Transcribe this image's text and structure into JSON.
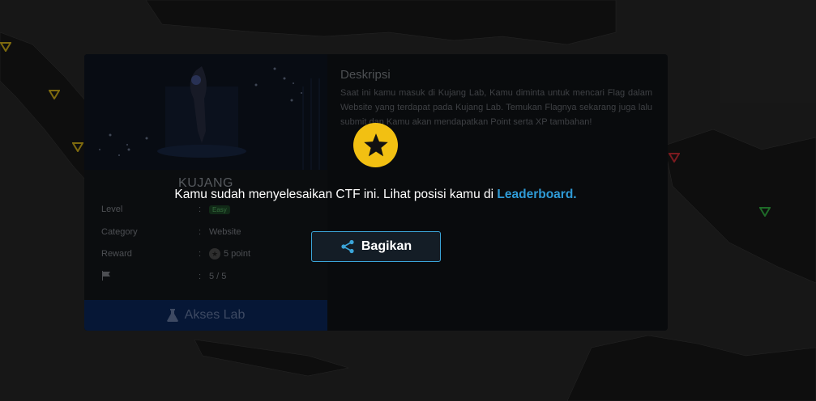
{
  "card": {
    "title": "KUJANG",
    "info": [
      {
        "key": "Level",
        "sep": ":",
        "value": "Easy"
      },
      {
        "key": "Category",
        "sep": ":",
        "value": "Website"
      },
      {
        "key": "Reward",
        "sep": ":",
        "value": "5 point"
      },
      {
        "sep": ":",
        "value": "5 / 5",
        "icon": "flag-icon"
      }
    ],
    "lab_button": "Akses Lab",
    "description_title": "Deskripsi",
    "description_text": "Saat ini kamu masuk di Kujang Lab, Kamu diminta untuk mencari Flag dalam Website yang terdapat pada Kujang Lab. Temukan Flagnya sekarang juga lalu submit dan Kamu akan mendapatkan Point serta XP tambahan!"
  },
  "modal": {
    "message": "Kamu sudah menyelesaikan CTF ini. Lihat posisi kamu di ",
    "link": "Leaderboard.",
    "share_button": "Bagikan"
  },
  "colors": {
    "accent": "#2f9bd6",
    "star": "#f2c012",
    "marker_yellow": "#e6c21a",
    "marker_red": "#e0303a",
    "marker_green": "#38c24a"
  }
}
